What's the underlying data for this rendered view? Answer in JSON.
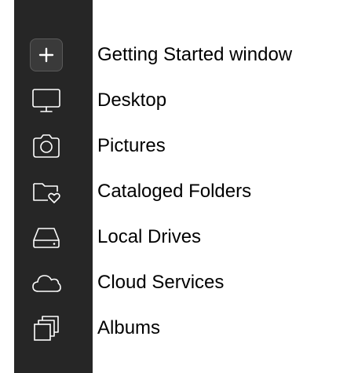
{
  "sidebar": {
    "items": [
      {
        "label": "Getting Started window",
        "icon": "plus-icon"
      },
      {
        "label": "Desktop",
        "icon": "monitor-icon"
      },
      {
        "label": "Pictures",
        "icon": "camera-icon"
      },
      {
        "label": "Cataloged Folders",
        "icon": "folder-heart-icon"
      },
      {
        "label": "Local Drives",
        "icon": "drive-icon"
      },
      {
        "label": "Cloud Services",
        "icon": "cloud-icon"
      },
      {
        "label": "Albums",
        "icon": "albums-icon"
      }
    ]
  }
}
